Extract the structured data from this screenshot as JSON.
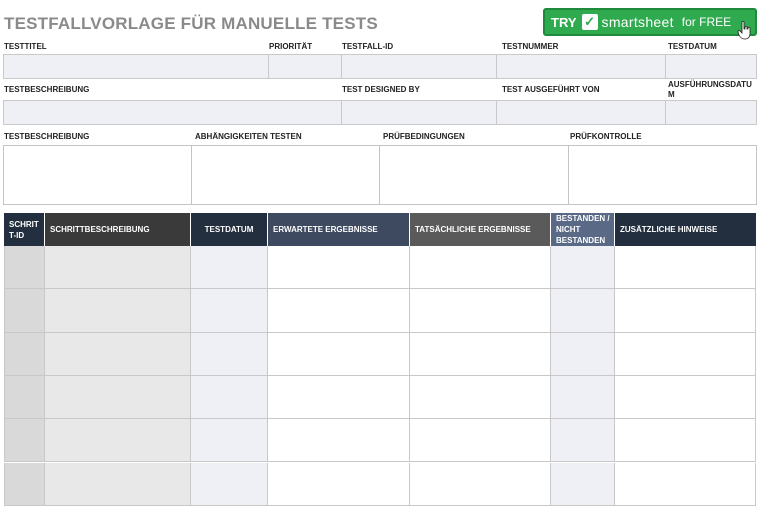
{
  "title": "TESTFALLVORLAGE FÜR MANUELLE TESTS",
  "promo": {
    "try": "TRY",
    "brand": "smartsheet",
    "free": "for FREE"
  },
  "header_fields": {
    "testtitel": "TESTTITEL",
    "prioritaet": "PRIORITÄT",
    "testfall_id": "TESTFALL-ID",
    "testnummer": "TESTNUMMER",
    "testdatum": "TESTDATUM",
    "testbeschreibung": "TESTBESCHREIBUNG",
    "test_designed_by": "TEST DESIGNED BY",
    "test_ausgefuehrt_von": "TEST AUSGEFÜHRT VON",
    "ausfuehrungsdatum_1": "AUSFÜHRUNGSDATU",
    "ausfuehrungsdatum_2": "M"
  },
  "details": {
    "testbeschreibung": "TESTBESCHREIBUNG",
    "abhaengigkeiten": "ABHÄNGIGKEITEN TESTEN",
    "pruefbedingungen": "PRÜFBEDINGUNGEN",
    "pruefkontrolle": "PRÜFKONTROLLE"
  },
  "steps_table": {
    "columns": [
      {
        "label_1": "SCHRIT",
        "label_2": "T-ID"
      },
      {
        "label_1": "SCHRITTBESCHREIBUNG",
        "label_2": ""
      },
      {
        "label_1": "TESTDATUM",
        "label_2": ""
      },
      {
        "label_1": "ERWARTETE ERGEBNISSE",
        "label_2": ""
      },
      {
        "label_1": "TATSÄCHLICHE ERGEBNISSE",
        "label_2": ""
      },
      {
        "label_1": "BESTANDEN /",
        "label_2": "NICHT",
        "label_3": "BESTANDEN"
      },
      {
        "label_1": "ZUSÄTZLICHE HINWEISE",
        "label_2": ""
      }
    ],
    "row_count": 6
  },
  "colors": {
    "header_dark": "#232f3e",
    "header_grey": "#5a5a5a",
    "header_blue": "#3d4a5f",
    "header_lightblue": "#5a6a86",
    "field_fill": "#eef0f5",
    "promo_green": "#2faa4e"
  }
}
